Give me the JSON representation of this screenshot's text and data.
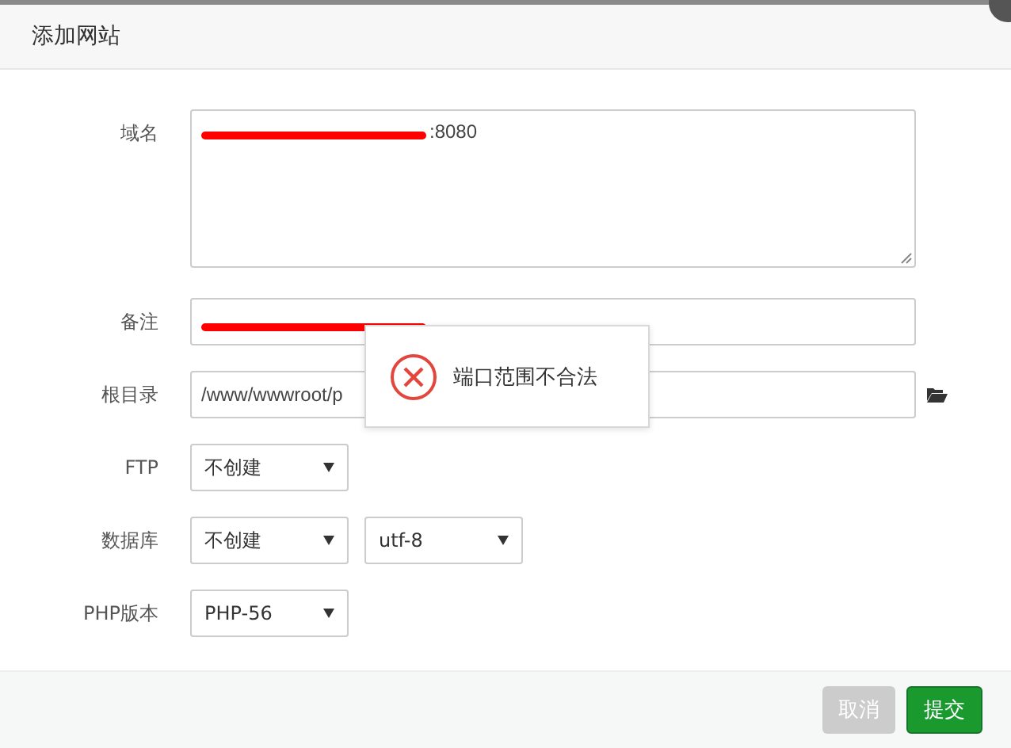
{
  "dialog": {
    "title": "添加网站"
  },
  "fields": [
    {
      "kind": "textarea",
      "label": "域名",
      "value": ":8080",
      "redacted": true
    },
    {
      "kind": "input",
      "label": "备注",
      "redacted": true
    },
    {
      "kind": "path",
      "label": "根目录",
      "value": "/www/wwwroot/p"
    },
    {
      "kind": "selects",
      "label": "FTP",
      "selects": [
        "不创建"
      ]
    },
    {
      "kind": "selects",
      "label": "数据库",
      "selects": [
        "不创建",
        "utf-8"
      ]
    },
    {
      "kind": "selects",
      "label": "PHP版本",
      "selects": [
        "PHP-56"
      ]
    }
  ],
  "toast": {
    "message": "端口范围不合法"
  },
  "buttons": [
    {
      "label": "取消",
      "disabled": true
    },
    {
      "label": "提交",
      "disabled": false
    }
  ]
}
